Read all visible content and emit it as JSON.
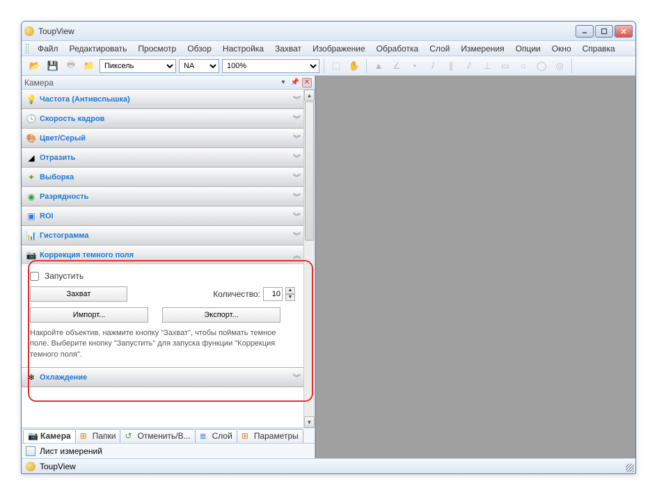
{
  "window": {
    "title": "ToupView"
  },
  "menu": [
    "Файл",
    "Редактировать",
    "Просмотр",
    "Обзор",
    "Настройка",
    "Захват",
    "Изображение",
    "Обработка",
    "Слой",
    "Измерения",
    "Опции",
    "Окно",
    "Справка"
  ],
  "toolbar": {
    "unit": "Пиксель",
    "na": "NA",
    "zoom": "100%"
  },
  "panel": {
    "title": "Камера",
    "items": [
      {
        "icon": "bulb",
        "label": "Частота (Антивспышка)"
      },
      {
        "icon": "clock",
        "label": "Скорость кадров"
      },
      {
        "icon": "palette",
        "label": "Цвет/Серый"
      },
      {
        "icon": "flip",
        "label": "Отразить"
      },
      {
        "icon": "sample",
        "label": "Выборка"
      },
      {
        "icon": "bits",
        "label": "Разрядность"
      },
      {
        "icon": "roi",
        "label": "ROI"
      },
      {
        "icon": "histo",
        "label": "Гистограмма"
      },
      {
        "icon": "dark",
        "label": "Коррекция темного поля"
      },
      {
        "icon": "cool",
        "label": "Охлаждение"
      }
    ]
  },
  "dark": {
    "enable": "Запустить",
    "capture": "Захват",
    "qty_label": "Количество:",
    "qty": "10",
    "import": "Импорт...",
    "export": "Экспорт...",
    "help": "Накройте объектив, нажмите кнопку \"Захват\", чтобы поймать темное поле. Выберите кнопку \"Запустить\" для запуска функции \"Коррекция темного поля\"."
  },
  "tabs": [
    {
      "icon": "camera",
      "label": "Камера",
      "active": true
    },
    {
      "icon": "folders",
      "label": "Папки",
      "active": false
    },
    {
      "icon": "undo",
      "label": "Отменить/В...",
      "active": false
    },
    {
      "icon": "layer",
      "label": "Слой",
      "active": false
    },
    {
      "icon": "params",
      "label": "Параметры",
      "active": false
    }
  ],
  "sheet": "Лист измерений",
  "status": "ToupView"
}
